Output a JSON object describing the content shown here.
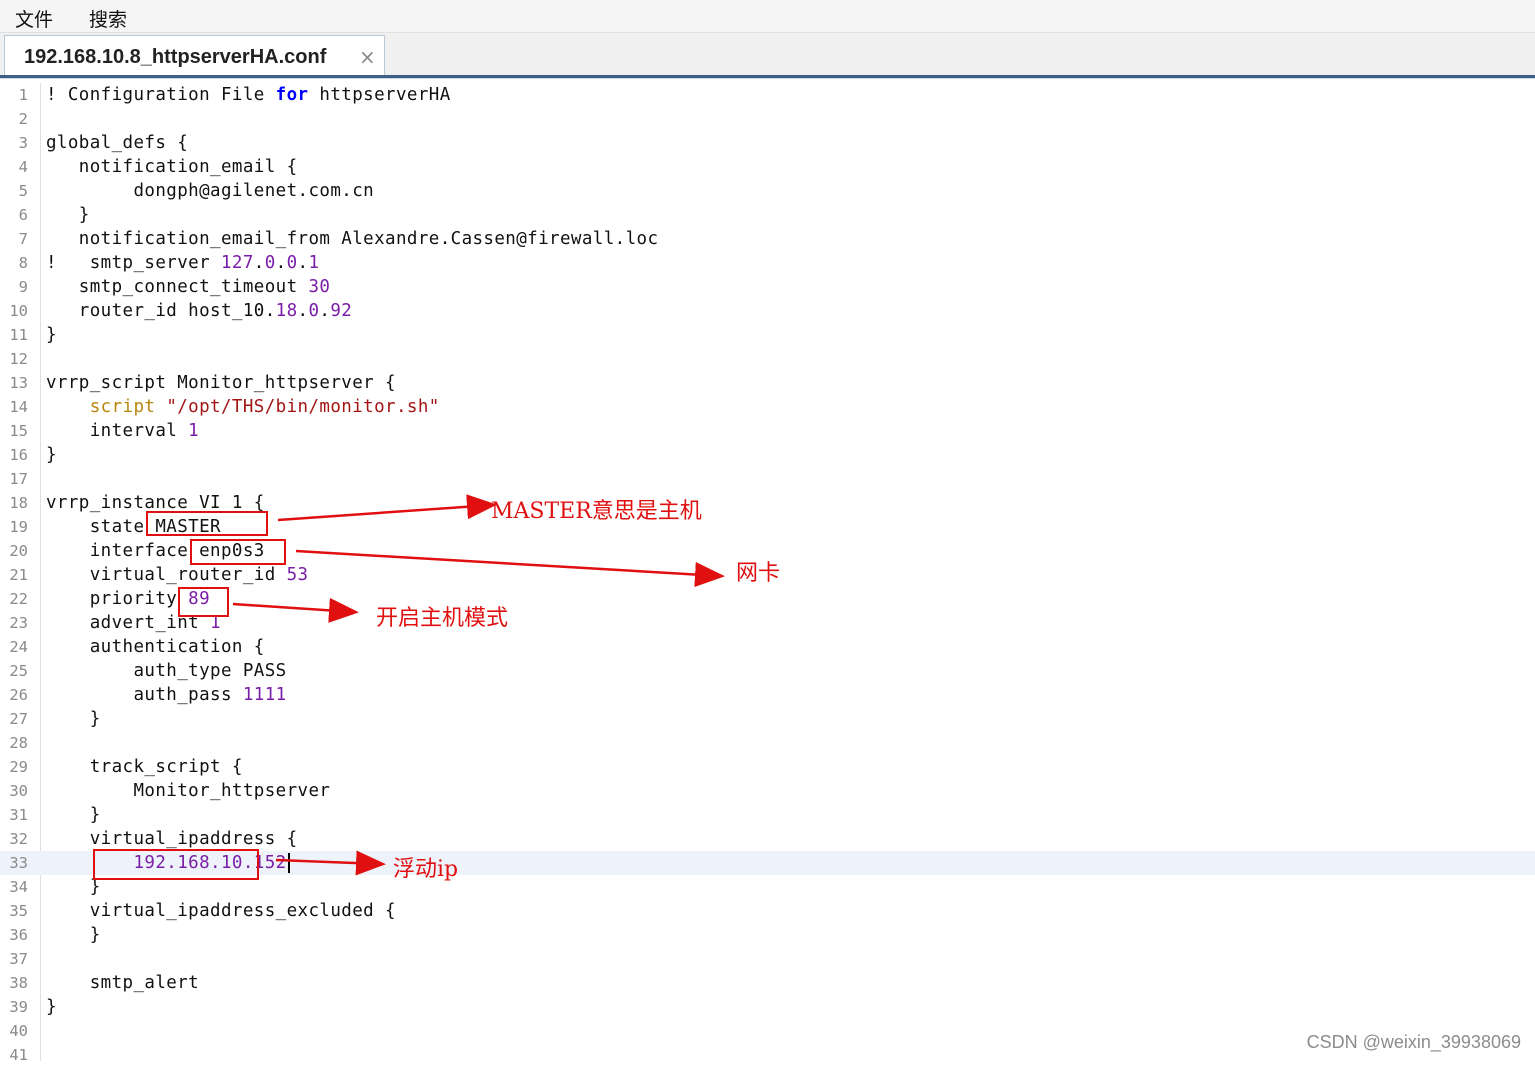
{
  "menu": {
    "file": "文件",
    "search": "搜索"
  },
  "tab": {
    "title": "192.168.10.8_httpserverHA.conf",
    "close": "×"
  },
  "lines": [
    {
      "n": "1",
      "html": "! Configuration File <span class='tk-kw'>for</span> httpserverHA"
    },
    {
      "n": "2",
      "html": ""
    },
    {
      "n": "3",
      "html": "global_defs {"
    },
    {
      "n": "4",
      "html": "   notification_email {"
    },
    {
      "n": "5",
      "html": "        dongph@agilenet.com.cn"
    },
    {
      "n": "6",
      "html": "   }"
    },
    {
      "n": "7",
      "html": "   notification_email_from Alexandre.Cassen@firewall.loc"
    },
    {
      "n": "8",
      "html": "!   smtp_server <span class='tk-num'>127</span>.<span class='tk-num'>0</span>.<span class='tk-num'>0</span>.<span class='tk-num'>1</span>"
    },
    {
      "n": "9",
      "html": "   smtp_connect_timeout <span class='tk-num'>30</span>"
    },
    {
      "n": "10",
      "html": "   router_id host_10.<span class='tk-num'>18</span>.<span class='tk-num'>0</span>.<span class='tk-num'>92</span>"
    },
    {
      "n": "11",
      "html": "}"
    },
    {
      "n": "12",
      "html": ""
    },
    {
      "n": "13",
      "html": "vrrp_script Monitor_httpserver {"
    },
    {
      "n": "14",
      "html": "    <span class='tk-script'>script</span> <span class='tk-str'>\"/opt/THS/bin/monitor.sh\"</span>"
    },
    {
      "n": "15",
      "html": "    interval <span class='tk-num'>1</span>"
    },
    {
      "n": "16",
      "html": "}"
    },
    {
      "n": "17",
      "html": ""
    },
    {
      "n": "18",
      "html": "vrrp_instance VI_1 {"
    },
    {
      "n": "19",
      "html": "    state MASTER"
    },
    {
      "n": "20",
      "html": "    interface enp0s3"
    },
    {
      "n": "21",
      "html": "    virtual_router_id <span class='tk-num'>53</span>"
    },
    {
      "n": "22",
      "html": "    priority <span class='tk-num'>89</span>"
    },
    {
      "n": "23",
      "html": "    advert_int <span class='tk-num'>1</span>"
    },
    {
      "n": "24",
      "html": "    authentication {"
    },
    {
      "n": "25",
      "html": "        auth_type PASS"
    },
    {
      "n": "26",
      "html": "        auth_pass <span class='tk-num'>1111</span>"
    },
    {
      "n": "27",
      "html": "    }"
    },
    {
      "n": "28",
      "html": ""
    },
    {
      "n": "29",
      "html": "    track_script {"
    },
    {
      "n": "30",
      "html": "        Monitor_httpserver"
    },
    {
      "n": "31",
      "html": "    }"
    },
    {
      "n": "32",
      "html": "    virtual_ipaddress {"
    },
    {
      "n": "33",
      "html": "        <span class='tk-ip'>192.168.10.152</span><span class='caret'></span>"
    },
    {
      "n": "34",
      "html": "    }"
    },
    {
      "n": "35",
      "html": "    virtual_ipaddress_excluded {"
    },
    {
      "n": "36",
      "html": "    }"
    },
    {
      "n": "37",
      "html": ""
    },
    {
      "n": "38",
      "html": "    smtp_alert"
    },
    {
      "n": "39",
      "html": "}"
    },
    {
      "n": "40",
      "html": ""
    },
    {
      "n": "41",
      "html": ""
    }
  ],
  "current_line": "33",
  "annotations": {
    "master": "MASTER意思是主机",
    "nic": "网卡",
    "priority": "开启主机模式",
    "vip": "浮动ip"
  },
  "watermark": "CSDN @weixin_39938069",
  "colors": {
    "annotation": "#e01010",
    "keyword": "#0000ff",
    "number": "#7a1ea8",
    "string": "#a31515"
  }
}
